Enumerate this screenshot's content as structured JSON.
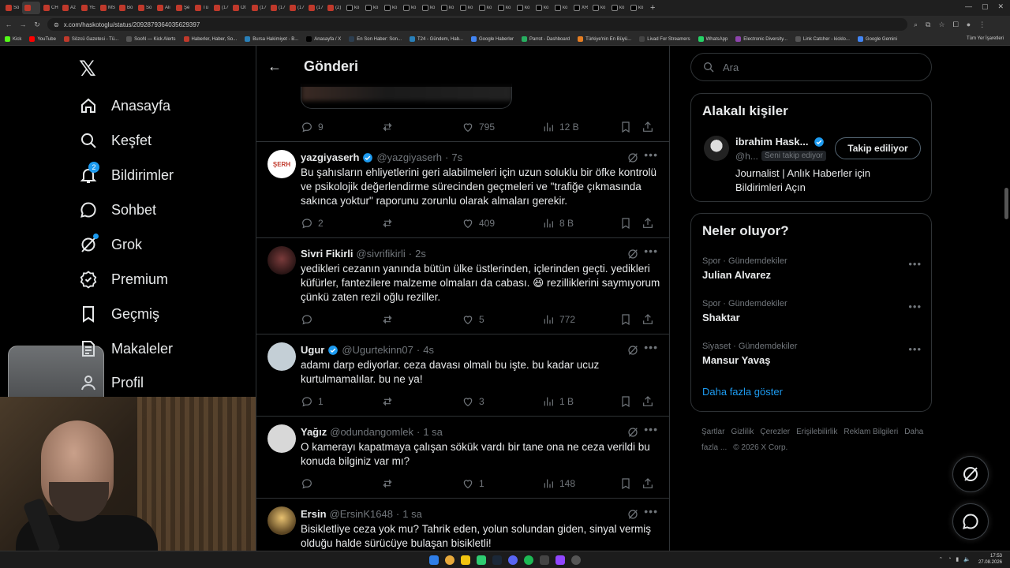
{
  "browser": {
    "url": "x.com/haskotoglu/status/2092879364035629397",
    "tabs": [
      "So",
      "",
      "CH",
      "Az",
      "YE",
      "MS",
      "Bo",
      "So",
      "Ali",
      "Şe",
      "Tü",
      "(17",
      "Ot",
      "(17",
      "(17",
      "(17",
      "(17",
      "(2)",
      "ko",
      "ko",
      "ko",
      "ko",
      "ko",
      "ko",
      "ko",
      "ko",
      "ko",
      "ko",
      "ko",
      "ko",
      "XR",
      "ko",
      "ko",
      "ko"
    ],
    "bookmarks": [
      "Kick",
      "YouTube",
      "Sözcü Gazetesi - Tü...",
      "SooN — Kick Alerts",
      "Haberler, Haber, So...",
      "Bursa Hakimiyet - B...",
      "Anasayfa / X",
      "En Son Haber: Son...",
      "T24 - Gündem, Hab...",
      "Google Haberler",
      "Parrot - Dashboard",
      "Türkiye'nin En Büyü...",
      "Livad For Streamers",
      "WhatsApp",
      "Electronic Diversity...",
      "Link Catcher - kicklo...",
      "Google Gemini"
    ],
    "bookmarks_right": "Tüm Yer İşaretleri"
  },
  "nav": {
    "items": [
      {
        "label": "Anasayfa",
        "icon": "home-icon"
      },
      {
        "label": "Keşfet",
        "icon": "search-icon"
      },
      {
        "label": "Bildirimler",
        "icon": "bell-icon",
        "badge": "2"
      },
      {
        "label": "Sohbet",
        "icon": "chat-icon"
      },
      {
        "label": "Grok",
        "icon": "grok-icon"
      },
      {
        "label": "Premium",
        "icon": "premium-icon"
      },
      {
        "label": "Geçmiş",
        "icon": "bookmark-icon"
      },
      {
        "label": "Makaleler",
        "icon": "article-icon"
      },
      {
        "label": "Profil",
        "icon": "profile-icon"
      }
    ]
  },
  "main": {
    "title": "Gönderi",
    "top_stats": {
      "replies": "9",
      "reposts": "",
      "likes": "795",
      "views": "12 B"
    },
    "posts": [
      {
        "name": "yazgiyaserh",
        "verified": true,
        "handle": "@yazgiyaserh",
        "time": "7s",
        "avatar_text": "ŞERH",
        "text": "Bu şahısların ehliyetlerini geri alabilmeleri için uzun soluklu bir öfke kontrolü ve psikolojik değerlendirme sürecinden geçmeleri ve \"trafiğe çıkmasında sakınca yoktur\" raporunu zorunlu olarak almaları gerekir.",
        "replies": "2",
        "reposts": "",
        "likes": "409",
        "views": "8 B"
      },
      {
        "name": "Sivri Fikirli",
        "verified": false,
        "handle": "@sivrifikirli",
        "time": "2s",
        "text": "yedikleri cezanın yanında bütün ülke üstlerinden, içlerinden geçti. yedikleri küfürler, fantezilere malzeme olmaları da cabası. 😆 rezilliklerini saymıyorum çünkü zaten rezil oğlu reziller.",
        "replies": "",
        "reposts": "",
        "likes": "5",
        "views": "772"
      },
      {
        "name": "Ugur",
        "verified": true,
        "handle": "@Ugurtekinn07",
        "time": "4s",
        "text": "adamı darp ediyorlar. ceza davası olmalı bu işte. bu kadar ucuz kurtulmamalılar. bu ne ya!",
        "replies": "1",
        "reposts": "",
        "likes": "3",
        "views": "1 B"
      },
      {
        "name": "Yağız",
        "verified": false,
        "handle": "@odundangomlek",
        "time": "1 sa",
        "text": "O kamerayı kapatmaya çalışan sökük vardı bir tane ona ne ceza verildi bu konuda bilginiz var mı?",
        "replies": "",
        "reposts": "",
        "likes": "1",
        "views": "148"
      },
      {
        "name": "Ersin",
        "verified": false,
        "handle": "@ErsinK1648",
        "time": "1 sa",
        "text": "Bisikletliye ceza yok mu? Tahrik eden, yolun solundan giden, sinyal vermiş olduğu halde sürücüye bulaşan bisikletli!",
        "replies": "",
        "reposts": "",
        "likes": "",
        "views": ""
      }
    ]
  },
  "right": {
    "search_placeholder": "Ara",
    "related_title": "Alakalı kişiler",
    "related": {
      "name": "ibrahim Hask...",
      "handle": "@h...",
      "follows_you": "Seni takip ediyor",
      "button": "Takip ediliyor",
      "bio": "Journalist | Anlık Haberler için Bildirimleri Açın"
    },
    "trends_title": "Neler oluyor?",
    "trends": [
      {
        "category": "Spor · Gündemdekiler",
        "name": "Julian Alvarez"
      },
      {
        "category": "Spor · Gündemdekiler",
        "name": "Shaktar"
      },
      {
        "category": "Siyaset · Gündemdekiler",
        "name": "Mansur Yavaş"
      }
    ],
    "show_more": "Daha fazla göster",
    "footer": [
      "Şartlar",
      "Gizlilik",
      "Çerezler",
      "Erişilebilirlik",
      "Reklam Bilgileri",
      "Daha fazla ...",
      "© 2026 X Corp."
    ]
  },
  "taskbar": {
    "time": "17:53",
    "date": "27.08.2026"
  },
  "colors": {
    "accent": "#1d9bf0",
    "muted": "#71767b",
    "border": "#2f3336",
    "background": "#000000"
  }
}
